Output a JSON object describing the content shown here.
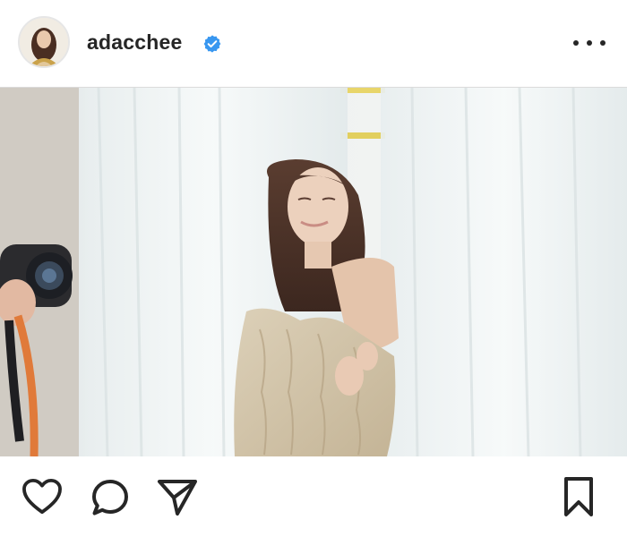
{
  "post": {
    "username": "adacchee",
    "verified": true,
    "accent_verified": "#3897f0"
  },
  "icons": {
    "avatar": "profile-avatar",
    "verified": "verified-badge-icon",
    "more": "more-options-icon",
    "like": "heart-icon",
    "comment": "comment-bubble-icon",
    "share": "paper-plane-icon",
    "save": "bookmark-icon"
  }
}
